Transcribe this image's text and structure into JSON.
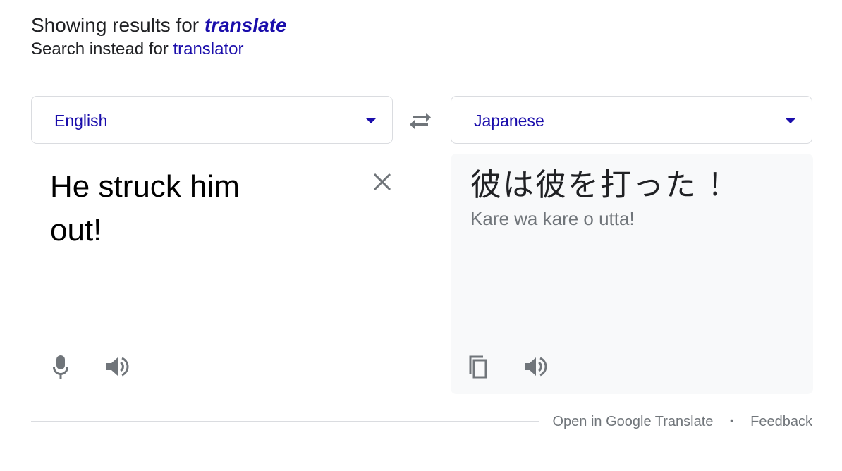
{
  "spelling": {
    "showing_prefix": "Showing results for",
    "corrected_query": "translate",
    "instead_prefix": "Search instead for",
    "original_query": "translator"
  },
  "source": {
    "language": "English",
    "text": "He struck him out!"
  },
  "target": {
    "language": "Japanese",
    "text": "彼は彼を打った ！",
    "romanization": "Kare wa kare o utta!"
  },
  "footer": {
    "open_link": "Open in Google Translate",
    "separator": "•",
    "feedback_link": "Feedback"
  },
  "colors": {
    "link": "#1a0dab",
    "icon": "#70757a",
    "target_bg": "#f8f9fa",
    "border": "#dadce0"
  },
  "icons": {
    "swap": "swap-arrows-icon",
    "clear": "close-icon",
    "mic": "microphone-icon",
    "speaker": "speaker-icon",
    "copy": "copy-icon",
    "caret": "caret-down-icon"
  }
}
